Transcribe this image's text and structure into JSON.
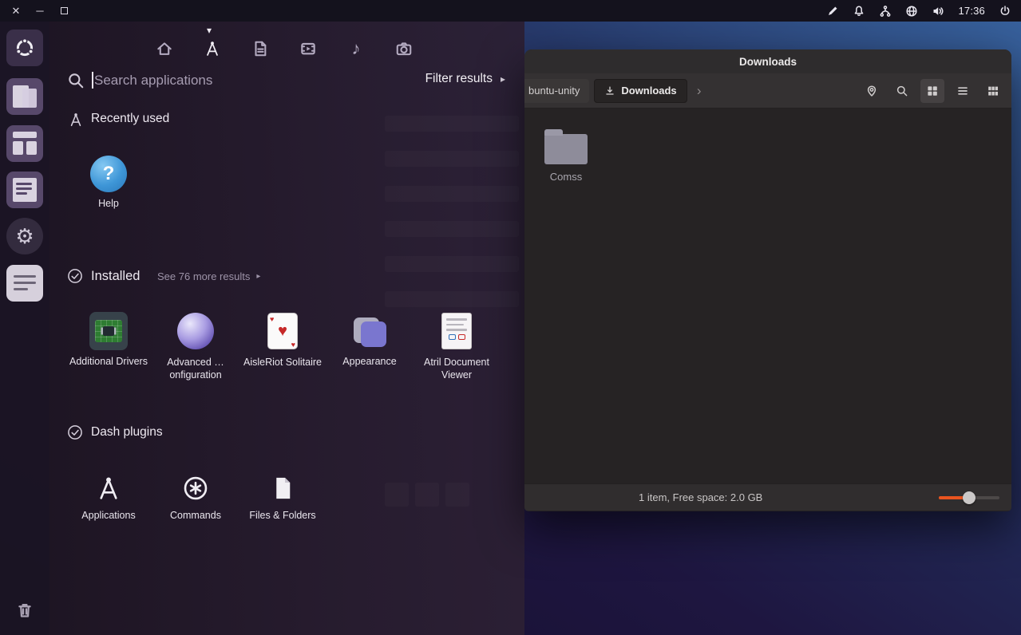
{
  "icons": {
    "close": "✕",
    "minimize": "─",
    "caret_down": "▾",
    "arrow_right": "▸",
    "chevron_right": "›",
    "gear": "⚙",
    "music_note": "♪",
    "heart": "♥",
    "heart_small": "♥",
    "question": "?"
  },
  "top_bar": {
    "clock": "17:36"
  },
  "dash": {
    "search": {
      "placeholder": "Search applications"
    },
    "filter": {
      "label": "Filter results"
    },
    "sections": {
      "recent": {
        "title": "Recently used",
        "items": [
          {
            "label": "Help"
          }
        ]
      },
      "installed": {
        "title": "Installed",
        "more_link": "See 76 more results",
        "items": [
          {
            "label": "Additional Drivers"
          },
          {
            "label": "Advanced …onfiguration"
          },
          {
            "label": "AisleRiot Solitaire"
          },
          {
            "label": "Appearance"
          },
          {
            "label": "Atril Document Viewer"
          }
        ]
      },
      "plugins": {
        "title": "Dash plugins",
        "items": [
          {
            "label": "Applications"
          },
          {
            "label": "Commands"
          },
          {
            "label": "Files & Folders"
          }
        ]
      }
    }
  },
  "file_manager": {
    "title": "Downloads",
    "toolbar": {
      "path_prev": "buntu-unity",
      "current": "Downloads"
    },
    "items": [
      {
        "label": "Comss"
      }
    ],
    "status": "1 item, Free space: 2.0 GB"
  }
}
